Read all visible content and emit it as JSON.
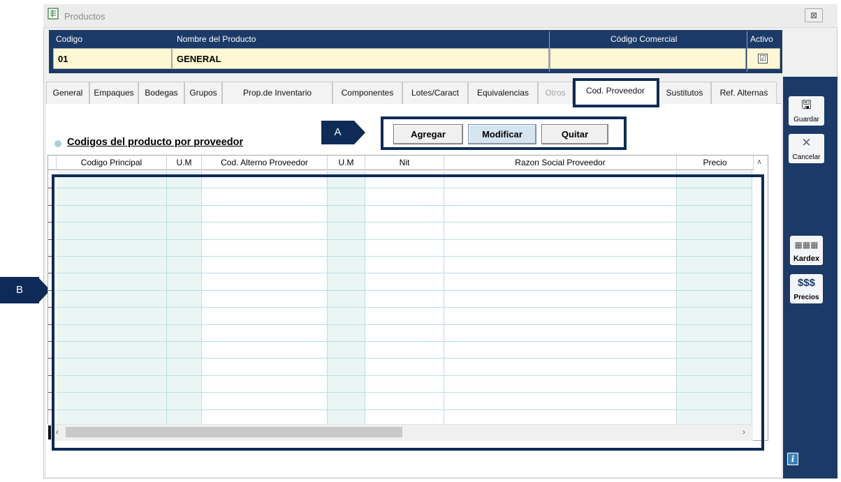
{
  "window": {
    "title": "Productos",
    "close_symbol": "⊠",
    "icon": "spreadsheet-icon"
  },
  "header": {
    "columns": [
      "Codigo",
      "Nombre del Producto",
      "Código Comercial",
      "Activo"
    ],
    "codigo_value": "01",
    "nombre_value": "GENERAL",
    "codigo_comercial_value": "",
    "activo_checked": "☑"
  },
  "tabs": [
    {
      "label": "General"
    },
    {
      "label": "Empaques"
    },
    {
      "label": "Bodegas"
    },
    {
      "label": "Grupos"
    },
    {
      "label": "Prop.de Inventario"
    },
    {
      "label": "Componentes"
    },
    {
      "label": "Lotes/Caract"
    },
    {
      "label": "Equivalencias"
    },
    {
      "label": "Otros"
    },
    {
      "label": "Cod. Proveedor"
    },
    {
      "label": "Sustitutos"
    },
    {
      "label": "Ref. Alternas"
    }
  ],
  "section": {
    "title": "Codigos del producto por proveedor"
  },
  "actions": {
    "agregar": "Agregar",
    "modificar": "Modificar",
    "quitar": "Quitar"
  },
  "grid": {
    "columns": [
      "Codigo Principal",
      "U.M",
      "Cod. Alterno  Proveedor",
      "U.M",
      "Nit",
      "Razon Social Proveedor",
      "Precio"
    ]
  },
  "toolbar": {
    "guardar": "Guardar",
    "cancelar": "Cancelar",
    "kardex": "Kardex",
    "precios_symbol": "$$$",
    "precios": "Precios",
    "info": "i"
  },
  "annotations": {
    "a": "A",
    "b": "B"
  },
  "colors": {
    "header_navy": "#1c3a67",
    "callout_navy": "#0e2a57",
    "field_yellow": "#fdf8d3",
    "grid_tint": "#eaf6f4"
  }
}
